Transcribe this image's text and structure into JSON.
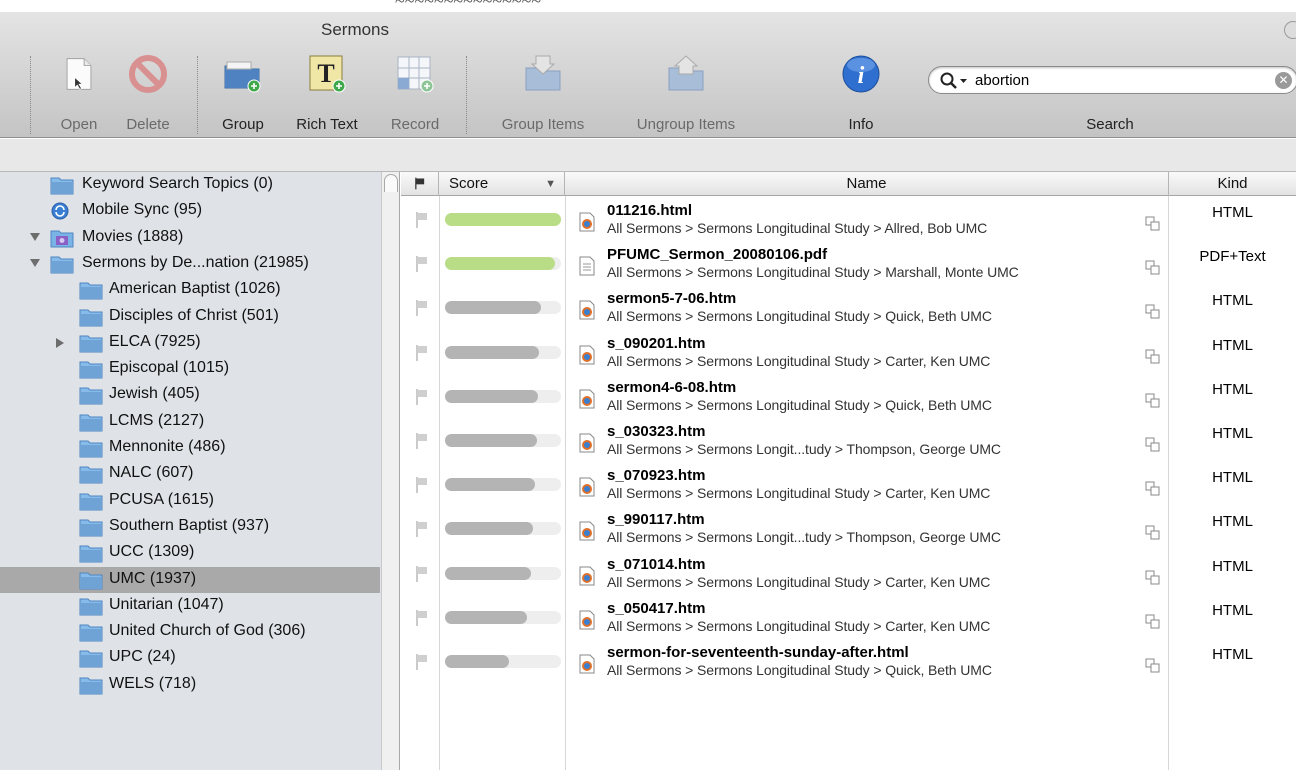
{
  "app": {
    "window_title": "Sermons"
  },
  "top_strip_text": "~~~~~~~~~~~~~~~",
  "toolbar": {
    "buttons": [
      {
        "id": "open",
        "label": "Open",
        "icon": "document-icon",
        "enabled": false
      },
      {
        "id": "delete",
        "label": "Delete",
        "icon": "no-entry-icon",
        "enabled": false
      },
      {
        "id": "group",
        "label": "Group",
        "icon": "new-group-icon",
        "enabled": true
      },
      {
        "id": "rich_text",
        "label": "Rich Text",
        "icon": "rich-text-icon",
        "enabled": true
      },
      {
        "id": "record",
        "label": "Record",
        "icon": "record-icon",
        "enabled": false
      },
      {
        "id": "group_items",
        "label": "Group Items",
        "icon": "group-items-icon",
        "enabled": false
      },
      {
        "id": "ungroup_items",
        "label": "Ungroup Items",
        "icon": "ungroup-items-icon",
        "enabled": false
      },
      {
        "id": "info",
        "label": "Info",
        "icon": "info-icon",
        "enabled": true
      }
    ],
    "search": {
      "value": "abortion",
      "label": "Search"
    }
  },
  "sidebar": {
    "items": [
      {
        "label": "Keyword Search Topics (0)",
        "icon": "folder-icon",
        "disclosure": "none",
        "indent": 0,
        "selected": false
      },
      {
        "label": "Mobile Sync (95)",
        "icon": "sync-icon",
        "disclosure": "none",
        "indent": 0,
        "selected": false
      },
      {
        "label": "Movies (1888)",
        "icon": "movie-folder-icon",
        "disclosure": "open",
        "indent": 0,
        "selected": false
      },
      {
        "label": "Sermons by De...nation (21985)",
        "icon": "folder-icon",
        "disclosure": "open",
        "indent": 0,
        "selected": false
      },
      {
        "label": "American Baptist (1026)",
        "icon": "folder-icon",
        "disclosure": "none",
        "indent": 1,
        "selected": false
      },
      {
        "label": "Disciples of Christ (501)",
        "icon": "folder-icon",
        "disclosure": "none",
        "indent": 1,
        "selected": false
      },
      {
        "label": "ELCA (7925)",
        "icon": "folder-icon",
        "disclosure": "closed",
        "indent": 1,
        "selected": false
      },
      {
        "label": "Episcopal (1015)",
        "icon": "folder-icon",
        "disclosure": "none",
        "indent": 1,
        "selected": false
      },
      {
        "label": "Jewish (405)",
        "icon": "folder-icon",
        "disclosure": "none",
        "indent": 1,
        "selected": false
      },
      {
        "label": "LCMS (2127)",
        "icon": "folder-icon",
        "disclosure": "none",
        "indent": 1,
        "selected": false
      },
      {
        "label": "Mennonite (486)",
        "icon": "folder-icon",
        "disclosure": "none",
        "indent": 1,
        "selected": false
      },
      {
        "label": "NALC (607)",
        "icon": "folder-icon",
        "disclosure": "none",
        "indent": 1,
        "selected": false
      },
      {
        "label": "PCUSA (1615)",
        "icon": "folder-icon",
        "disclosure": "none",
        "indent": 1,
        "selected": false
      },
      {
        "label": "Southern Baptist (937)",
        "icon": "folder-icon",
        "disclosure": "none",
        "indent": 1,
        "selected": false
      },
      {
        "label": "UCC (1309)",
        "icon": "folder-icon",
        "disclosure": "none",
        "indent": 1,
        "selected": false
      },
      {
        "label": "UMC (1937)",
        "icon": "folder-icon",
        "disclosure": "none",
        "indent": 1,
        "selected": true
      },
      {
        "label": "Unitarian (1047)",
        "icon": "folder-icon",
        "disclosure": "none",
        "indent": 1,
        "selected": false
      },
      {
        "label": "United Church of God (306)",
        "icon": "folder-icon",
        "disclosure": "none",
        "indent": 1,
        "selected": false
      },
      {
        "label": "UPC (24)",
        "icon": "folder-icon",
        "disclosure": "none",
        "indent": 1,
        "selected": false
      },
      {
        "label": "WELS (718)",
        "icon": "folder-icon",
        "disclosure": "none",
        "indent": 1,
        "selected": false
      }
    ]
  },
  "table": {
    "columns": {
      "score": "Score",
      "name": "Name",
      "kind": "Kind"
    },
    "rows": [
      {
        "name": "011216.html",
        "path": "All Sermons > Sermons Longitudinal Study > Allred, Bob UMC",
        "kind": "HTML",
        "score": 1.0,
        "doc_type": "html"
      },
      {
        "name": "PFUMC_Sermon_20080106.pdf",
        "path": "All Sermons > Sermons Longitudinal Study > Marshall, Monte UMC",
        "kind": "PDF+Text",
        "score": 0.95,
        "doc_type": "pdf"
      },
      {
        "name": "sermon5-7-06.htm",
        "path": "All Sermons > Sermons Longitudinal Study > Quick, Beth UMC",
        "kind": "HTML",
        "score": 0.83,
        "doc_type": "html"
      },
      {
        "name": "s_090201.htm",
        "path": "All Sermons > Sermons Longitudinal Study > Carter, Ken UMC",
        "kind": "HTML",
        "score": 0.81,
        "doc_type": "html"
      },
      {
        "name": "sermon4-6-08.htm",
        "path": "All Sermons > Sermons Longitudinal Study > Quick, Beth UMC",
        "kind": "HTML",
        "score": 0.8,
        "doc_type": "html"
      },
      {
        "name": "s_030323.htm",
        "path": "All Sermons > Sermons Longit...tudy > Thompson, George UMC",
        "kind": "HTML",
        "score": 0.79,
        "doc_type": "html"
      },
      {
        "name": "s_070923.htm",
        "path": "All Sermons > Sermons Longitudinal Study > Carter, Ken UMC",
        "kind": "HTML",
        "score": 0.78,
        "doc_type": "html"
      },
      {
        "name": "s_990117.htm",
        "path": "All Sermons > Sermons Longit...tudy > Thompson, George UMC",
        "kind": "HTML",
        "score": 0.76,
        "doc_type": "html"
      },
      {
        "name": "s_071014.htm",
        "path": "All Sermons > Sermons Longitudinal Study > Carter, Ken UMC",
        "kind": "HTML",
        "score": 0.74,
        "doc_type": "html"
      },
      {
        "name": "s_050417.htm",
        "path": "All Sermons > Sermons Longitudinal Study > Carter, Ken UMC",
        "kind": "HTML",
        "score": 0.71,
        "doc_type": "html"
      },
      {
        "name": "sermon-for-seventeenth-sunday-after.html",
        "path": "All Sermons > Sermons Longitudinal Study > Quick, Beth UMC",
        "kind": "HTML",
        "score": 0.55,
        "doc_type": "html"
      }
    ]
  },
  "colors": {
    "score_high": "#b9dc86",
    "score_normal": "#b4b4b4",
    "folder": "#6fa3d6",
    "selection": "#a9a9a9",
    "info_blue": "#2e6fd0"
  }
}
